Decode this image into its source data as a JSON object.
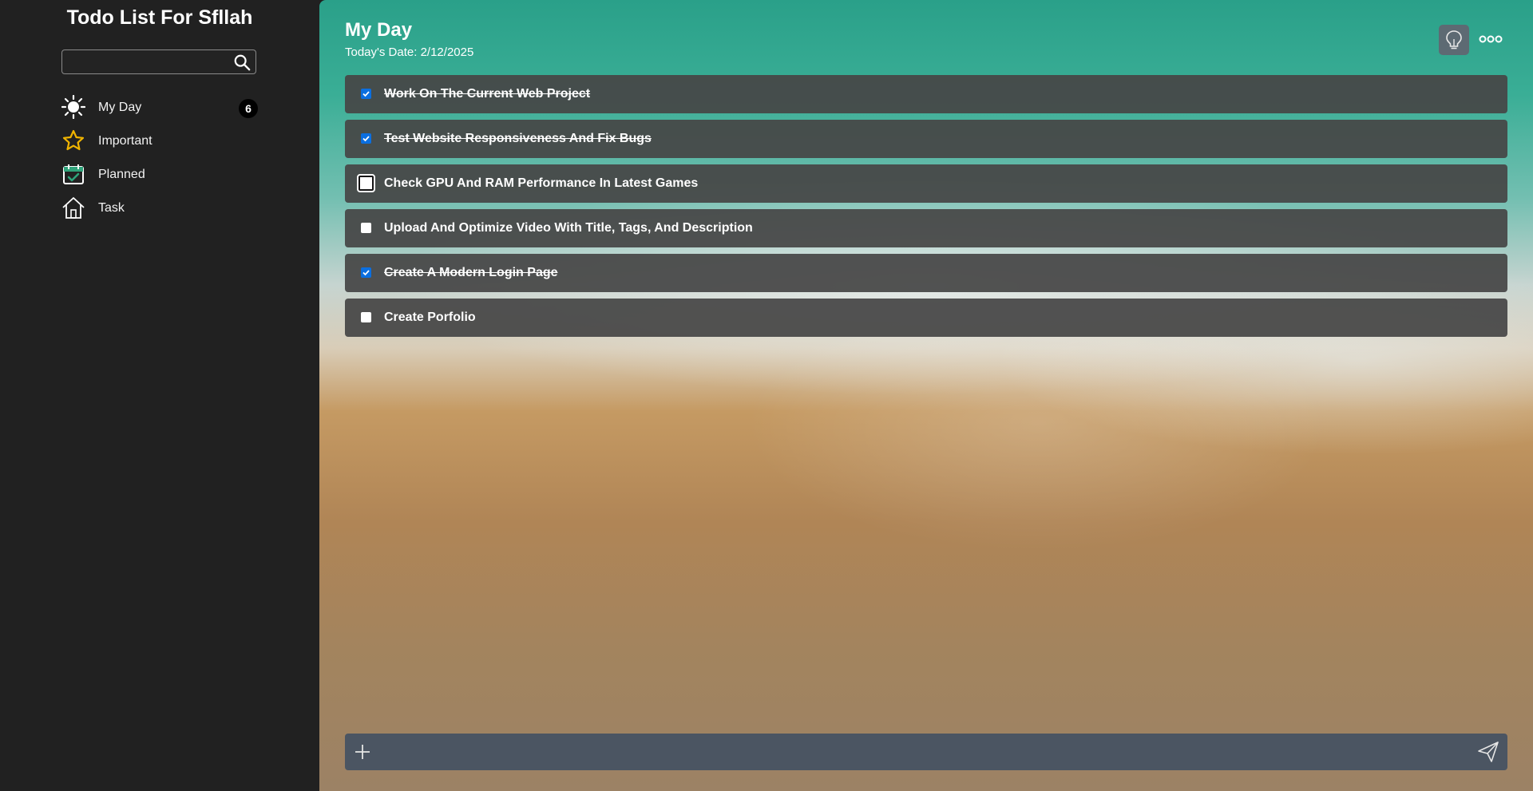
{
  "sidebar": {
    "title": "Todo List For Sfllah",
    "search": {
      "value": "",
      "placeholder": ""
    },
    "items": [
      {
        "label": "My Day",
        "icon": "sun-icon",
        "badge": "6"
      },
      {
        "label": "Important",
        "icon": "star-icon",
        "icon_color": "#f0b400"
      },
      {
        "label": "Planned",
        "icon": "calendar-icon",
        "icon_color": "#2fa37a"
      },
      {
        "label": "Task",
        "icon": "home-icon"
      }
    ]
  },
  "main": {
    "title": "My Day",
    "date": "Today's Date: 2/12/2025",
    "tasks": [
      {
        "text": "Work On The Current Web Project",
        "done": true
      },
      {
        "text": "Test Website Responsiveness And Fix Bugs",
        "done": true
      },
      {
        "text": "Check GPU And RAM Performance In Latest Games",
        "done": false
      },
      {
        "text": "Upload And Optimize Video With Title, Tags, And Description",
        "done": false
      },
      {
        "text": "Create A Modern Login Page",
        "done": true
      },
      {
        "text": "Create Porfolio",
        "done": false
      }
    ],
    "add_task": {
      "value": "",
      "placeholder": ""
    }
  },
  "colors": {
    "sidebar_bg": "#212121",
    "task_bg": "#464646",
    "checkbox_checked": "#0b6fe0",
    "add_bar_bg": "#4b5562"
  }
}
